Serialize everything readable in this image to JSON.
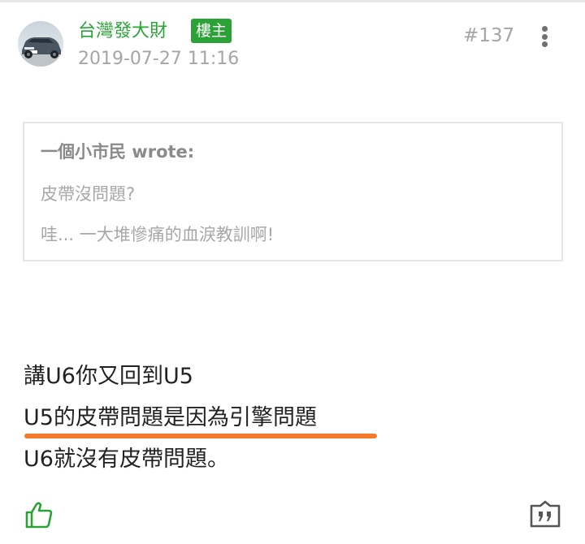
{
  "post": {
    "author": "台灣發大財",
    "badge": "樓主",
    "timestamp": "2019-07-27 11:16",
    "number": "#137"
  },
  "quote": {
    "author": "一個小市民 wrote:",
    "lines": [
      "皮帶沒問題?",
      "哇... 一大堆慘痛的血淚教訓啊!"
    ]
  },
  "body": {
    "lines": [
      "講U6你又回到U5",
      "U5的皮帶問題是因為引擎問題",
      "U6就沒有皮帶問題。"
    ]
  },
  "colors": {
    "author_green": "#29a536",
    "badge_green": "#2aa236",
    "underline_orange": "#f47b2a",
    "meta_gray": "#a5a5a5"
  },
  "icons": {
    "like": "thumbs-up-icon",
    "quote_reply": "quote-icon",
    "more": "more-vertical-icon"
  }
}
